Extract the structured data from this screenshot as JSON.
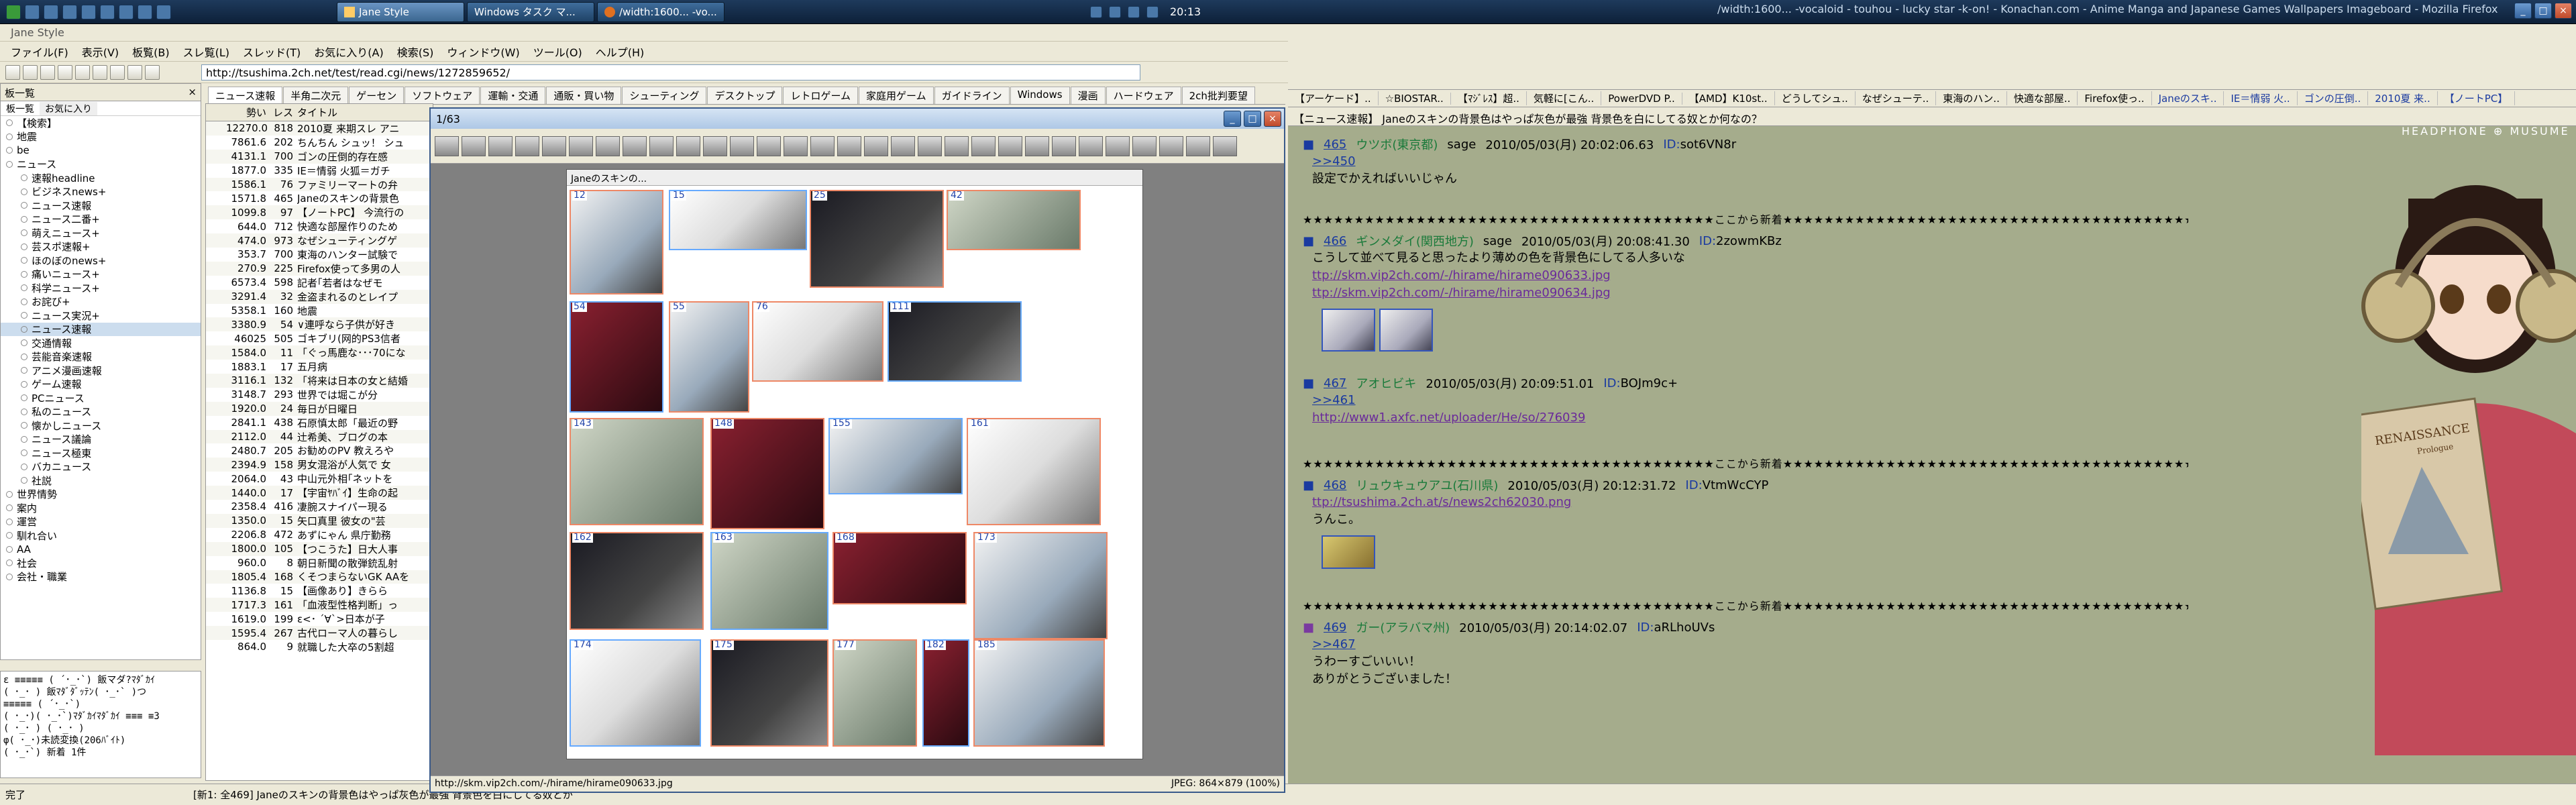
{
  "taskbar": {
    "windows": [
      {
        "label": "Jane Style",
        "active": true
      },
      {
        "label": "Windows タスク マ...",
        "active": false
      },
      {
        "label": "/width:1600... -vo...",
        "active": false
      }
    ],
    "clock": "20:13",
    "ff_title": "/width:1600... -vocaloid - touhou - lucky star -k-on! - Konachan.com - Anime Manga and Japanese Games Wallpapers Imageboard - Mozilla Firefox"
  },
  "jane": {
    "title": "Jane Style",
    "menu": [
      "ファイル(F)",
      "表示(V)",
      "板覧(B)",
      "スレ覧(L)",
      "スレッド(T)",
      "お気に入り(A)",
      "検索(S)",
      "ウィンドウ(W)",
      "ツール(O)",
      "ヘルプ(H)"
    ],
    "url": "http://tsushima.2ch.net/test/read.cgi/news/1272859652/",
    "board_tabs": [
      "ニュース速報",
      "半角二次元",
      "ゲーセン",
      "ソフトウェア",
      "運輸・交通",
      "通販・買い物",
      "シューティング",
      "デスクトップ",
      "レトロゲーム",
      "家庭用ゲーム",
      "ガイドライン",
      "Windows",
      "漫画",
      "ハードウェア",
      "2ch批判要望"
    ],
    "tree_header": "板一覧",
    "tree_tabs": [
      "板一覧",
      "お気に入り"
    ],
    "tree": [
      {
        "label": "【検索】",
        "sub": false
      },
      {
        "label": "地震",
        "sub": false
      },
      {
        "label": "be",
        "sub": false
      },
      {
        "label": "ニュース",
        "sub": false
      },
      {
        "label": "速報headline",
        "sub": true
      },
      {
        "label": "ビジネスnews+",
        "sub": true
      },
      {
        "label": "ニュース速報",
        "sub": true
      },
      {
        "label": "ニュース二番+",
        "sub": true
      },
      {
        "label": "萌えニュース+",
        "sub": true
      },
      {
        "label": "芸スポ速報+",
        "sub": true
      },
      {
        "label": "ほのぼのnews+",
        "sub": true
      },
      {
        "label": "痛いニュース+",
        "sub": true
      },
      {
        "label": "科学ニュース+",
        "sub": true
      },
      {
        "label": "お詫び+",
        "sub": true
      },
      {
        "label": "ニュース実況+",
        "sub": true
      },
      {
        "label": "ニュース速報",
        "sub": true,
        "sel": true
      },
      {
        "label": "交通情報",
        "sub": true
      },
      {
        "label": "芸能音楽速報",
        "sub": true
      },
      {
        "label": "アニメ漫画速報",
        "sub": true
      },
      {
        "label": "ゲーム速報",
        "sub": true
      },
      {
        "label": "PCニュース",
        "sub": true
      },
      {
        "label": "私のニュース",
        "sub": true
      },
      {
        "label": "懐かしニュース",
        "sub": true
      },
      {
        "label": "ニュース議論",
        "sub": true
      },
      {
        "label": "ニュース極東",
        "sub": true
      },
      {
        "label": "バカニュース",
        "sub": true
      },
      {
        "label": "社説",
        "sub": true
      },
      {
        "label": "世界情勢",
        "sub": false
      },
      {
        "label": "案内",
        "sub": false
      },
      {
        "label": "運営",
        "sub": false
      },
      {
        "label": "馴れ合い",
        "sub": false
      },
      {
        "label": "AA",
        "sub": false
      },
      {
        "label": "社会",
        "sub": false
      },
      {
        "label": "会社・職業",
        "sub": false
      }
    ],
    "kaomoji": "ε ≡≡≡≡≡ ( ´･_･`) 飯マダ?ﾏﾀﾞｶｲ\n( ･_･ ) 飯ﾏﾀﾞﾀﾞｯﾃﾝ( ･_･` )つ\n≡≡≡≡≡ ( ´･_･`)\n( ･_･)( ･_･`)ﾏﾀﾞｶｲﾏﾀﾞｶｲ ≡≡≡ ≡3\n( ･_･ ) ( ･_･ )\nφ( ･_･)未読変換(206ﾊﾞｲﾄ)\n( ･_･`) 新着 1件",
    "list_header": {
      "n": "勢い",
      "res": "レス",
      "title": "タイトル"
    },
    "threads": [
      {
        "n": "12270.0",
        "res": "818",
        "title": "2010夏 来期スレ アニ"
      },
      {
        "n": "7861.6",
        "res": "202",
        "title": "ちんちん シュッ！ シュ"
      },
      {
        "n": "4131.1",
        "res": "700",
        "title": "ゴンの圧倒的存在感"
      },
      {
        "n": "1877.0",
        "res": "335",
        "title": "IE＝情弱 火狐＝ガチ"
      },
      {
        "n": "1586.1",
        "res": "76",
        "title": "ファミリーマートの弁"
      },
      {
        "n": "1571.8",
        "res": "465",
        "title": "Janeのスキンの背景色"
      },
      {
        "n": "1099.8",
        "res": "97",
        "title": "【ノートPC】 今流行の"
      },
      {
        "n": "644.0",
        "res": "712",
        "title": "快適な部屋作りのため"
      },
      {
        "n": "474.0",
        "res": "973",
        "title": "なぜシューティングゲ"
      },
      {
        "n": "353.7",
        "res": "700",
        "title": "東海のハンター試験で"
      },
      {
        "n": "270.9",
        "res": "225",
        "title": "Firefox使って多男の人"
      },
      {
        "n": "6573.4",
        "res": "598",
        "title": "記者｢若者はなぜモ"
      },
      {
        "n": "3291.4",
        "res": "32",
        "title": "金盗まれるのとレイプ"
      },
      {
        "n": "5358.1",
        "res": "160",
        "title": "地震"
      },
      {
        "n": "3380.9",
        "res": "54",
        "title": "∨連呼なら子供が好き"
      },
      {
        "n": "46025",
        "res": "505",
        "title": "ゴキブリ(网的PS3信者"
      },
      {
        "n": "1584.0",
        "res": "11",
        "title": "「ぐっ馬鹿な･･･70にな"
      },
      {
        "n": "1883.1",
        "res": "17",
        "title": "五月病"
      },
      {
        "n": "3116.1",
        "res": "132",
        "title": "「将来は日本の女と結婚"
      },
      {
        "n": "3148.7",
        "res": "293",
        "title": "世界では堀こが分"
      },
      {
        "n": "1920.0",
        "res": "24",
        "title": "毎日が日曜日"
      },
      {
        "n": "2841.1",
        "res": "438",
        "title": "石原慎太郎「最近の野"
      },
      {
        "n": "2112.0",
        "res": "44",
        "title": "辻希美、ブログの本"
      },
      {
        "n": "2480.7",
        "res": "205",
        "title": "お勧めのPV 教えろや"
      },
      {
        "n": "2394.9",
        "res": "158",
        "title": "男女混浴が人気で 女"
      },
      {
        "n": "2064.0",
        "res": "43",
        "title": "中山元外相｢ネットを"
      },
      {
        "n": "1440.0",
        "res": "17",
        "title": "【宇宙ﾔﾊﾞｲ】生命の起"
      },
      {
        "n": "2358.4",
        "res": "416",
        "title": "凄腕スナイパー現る"
      },
      {
        "n": "1350.0",
        "res": "15",
        "title": "矢口真里 彼女の\"芸"
      },
      {
        "n": "2206.8",
        "res": "472",
        "title": "あずにゃん 県庁勤務"
      },
      {
        "n": "1800.0",
        "res": "105",
        "title": "【つこうた】日大人事"
      },
      {
        "n": "960.0",
        "res": "8",
        "title": "朝日新聞の散弾銃乱射"
      },
      {
        "n": "1805.4",
        "res": "168",
        "title": "くそつまらないGK AAを"
      },
      {
        "n": "1136.8",
        "res": "15",
        "title": "【画像あり】きらら"
      },
      {
        "n": "1717.3",
        "res": "161",
        "title": "「血液型性格判断」っ"
      },
      {
        "n": "1619.0",
        "res": "199",
        "title": "ε<･ ´∀`>日本が子"
      },
      {
        "n": "1595.4",
        "res": "267",
        "title": "古代ローマ人の暮らし"
      },
      {
        "n": "864.0",
        "res": "9",
        "title": "就職した大卒の5割超"
      }
    ],
    "status": "完了",
    "status_detail": "[新1: 全469] Janeのスキンの背景色はやっぱ灰色が最強 背景色を白にしてる奴とか"
  },
  "viewer": {
    "title": "1/63",
    "page_label": "Janeのスキンの...",
    "url": "http://skm.vip2ch.com/-/hirame/hirame090633.jpg",
    "info": "JPEG: 864×879 (100%)",
    "shot_numbers": [
      "12",
      "15",
      "25",
      "42",
      "54",
      "55",
      "76",
      "111",
      "143",
      "148",
      "155",
      "161",
      "162",
      "163",
      "168",
      "173",
      "174",
      "175",
      "177",
      "182",
      "185"
    ]
  },
  "firefox": {
    "bookmarks": [
      "【アーケード】..",
      "☆BIOSTAR..",
      "【ﾏｼﾞﾚｽ】超..",
      "気軽に[こん..",
      "PowerDVD P..",
      "【AMD】K10st..",
      "どうしてシュ..",
      "なぜシューテ..",
      "東海のハン..",
      "快適な部屋..",
      "Firefox使っ..",
      "Janeのスキ..",
      "IE＝情弱 火..",
      "ゴンの圧倒..",
      "2010夏 来..",
      "【ノートPC】"
    ],
    "thread_title": "【ニュース速報】 Janeのスキンの背景色はやっぱ灰色が最強 背景色を白にしてる奴とか何なの？",
    "brand": "HEADPHONE ⊕ MUSUME",
    "sep_text": "★★★★★★★★★★★★★★★★★★★★★★★★★★★★★★★★★★★★★★★★ここから新着★★★★★★★★★★★★★★★★★★★★★★★★★★★★★★★★★★★★★★★★",
    "posts": [
      {
        "num": "465",
        "name": "ウツボ(東京都)",
        "mail": "sage",
        "date": "2010/05/03(月) 20:02:06.63",
        "id_label": "ID:",
        "id": "sot6VN8r",
        "lines": [
          ">>450",
          "設定でかえればいいじゃん"
        ],
        "links": []
      },
      {
        "num": "466",
        "name": "ギンメダイ(関西地方)",
        "mail": "sage",
        "date": "2010/05/03(月) 20:08:41.30",
        "id_label": "ID:",
        "id": "2zowmKBz",
        "lines": [
          "こうして並べて見ると思ったより薄めの色を背景色にしてる人多いな"
        ],
        "links": [
          "ttp://skm.vip2ch.com/-/hirame/hirame090633.jpg",
          "ttp://skm.vip2ch.com/-/hirame/hirame090634.jpg"
        ]
      },
      {
        "num": "467",
        "name": "アオヒビキ",
        "mail": "",
        "date": "2010/05/03(月) 20:09:51.01",
        "id_label": "ID:",
        "id": "BOJm9c+",
        "lines": [
          ">>461"
        ],
        "links": [
          "http://www1.axfc.net/uploader/He/so/276039"
        ]
      },
      {
        "num": "468",
        "name": "リュウキュウアユ(石川県)",
        "mail": "",
        "date": "2010/05/03(月) 20:12:31.72",
        "id_label": "ID:",
        "id": "VtmWcCYP",
        "lines": [],
        "links": [
          "ttp://tsushima.2ch.at/s/news2ch62030.png"
        ],
        "after": "うんこ。"
      },
      {
        "num": "469",
        "name": "ガー(アラバマ州)",
        "mail": "",
        "date": "2010/05/03(月) 20:14:02.07",
        "id_label": "ID:",
        "id": "aRLhoUVs",
        "lines": [
          ">>467",
          "うわーすごいいい！",
          "ありがとうございました！"
        ],
        "links": []
      }
    ],
    "album_title": "RENAISSANCE",
    "album_sub": "Prologue"
  }
}
